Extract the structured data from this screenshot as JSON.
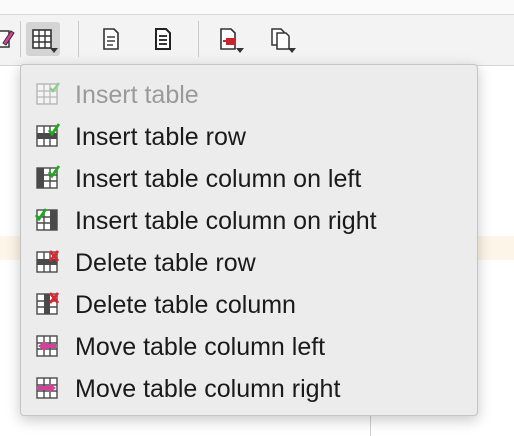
{
  "toolbar": {
    "buttons": [
      {
        "name": "edit-icon"
      },
      {
        "name": "table-icon",
        "active": true,
        "dropdown": true
      },
      {
        "name": "document-icon"
      },
      {
        "name": "document-lines-icon"
      },
      {
        "name": "document-export-icon",
        "dropdown": true
      },
      {
        "name": "document-copy-icon",
        "dropdown": true
      }
    ]
  },
  "menu": {
    "items": [
      {
        "label": "Insert table",
        "icon": "table-insert-icon",
        "enabled": false
      },
      {
        "label": "Insert table row",
        "icon": "table-row-insert-icon",
        "enabled": true
      },
      {
        "label": "Insert table column on left",
        "icon": "table-column-insert-left-icon",
        "enabled": true
      },
      {
        "label": "Insert table column on right",
        "icon": "table-column-insert-right-icon",
        "enabled": true
      },
      {
        "label": "Delete table row",
        "icon": "table-row-delete-icon",
        "enabled": true
      },
      {
        "label": "Delete table column",
        "icon": "table-column-delete-icon",
        "enabled": true
      },
      {
        "label": "Move table column left",
        "icon": "table-column-move-left-icon",
        "enabled": true
      },
      {
        "label": "Move table column right",
        "icon": "table-column-move-right-icon",
        "enabled": true
      }
    ]
  },
  "colors": {
    "check": "#22a81e",
    "delete": "#e0242c",
    "move": "#d6409a",
    "grid": "#4a4a4a"
  }
}
